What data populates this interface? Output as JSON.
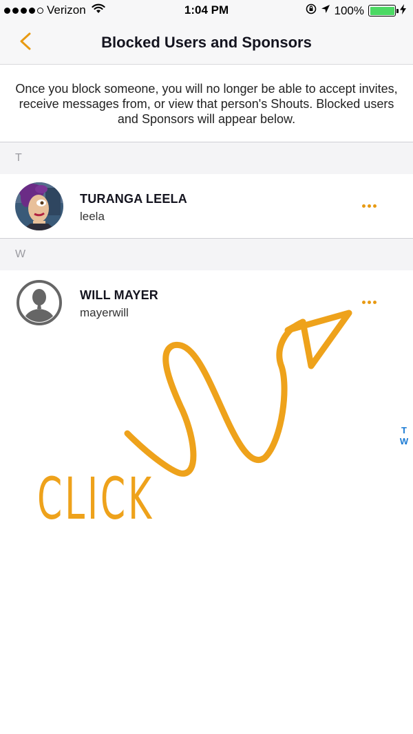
{
  "status_bar": {
    "carrier": "Verizon",
    "time": "1:04 PM",
    "battery_percent": "100%",
    "battery_level": 1.0,
    "signal_bars_filled": 4,
    "signal_bars_total": 5
  },
  "nav": {
    "title": "Blocked Users and Sponsors",
    "back_icon": "chevron-left-icon"
  },
  "info_text": "Once you block someone, you will no longer be able to accept invites, receive messages from, or view that person's Shouts. Blocked users and Sponsors will appear below.",
  "sections": [
    {
      "letter": "T",
      "users": [
        {
          "name": "TURANGA LEELA",
          "handle": "leela",
          "avatar": "cartoon-avatar"
        }
      ]
    },
    {
      "letter": "W",
      "users": [
        {
          "name": "WILL MAYER",
          "handle": "mayerwill",
          "avatar": "default-person-avatar"
        }
      ]
    }
  ],
  "section_index": [
    "T",
    "W"
  ],
  "annotation": {
    "text": "CLICK",
    "color": "#eea21b"
  },
  "colors": {
    "accent": "#e89a13",
    "index_blue": "#1a7ad4",
    "battery_green": "#4cd964"
  }
}
